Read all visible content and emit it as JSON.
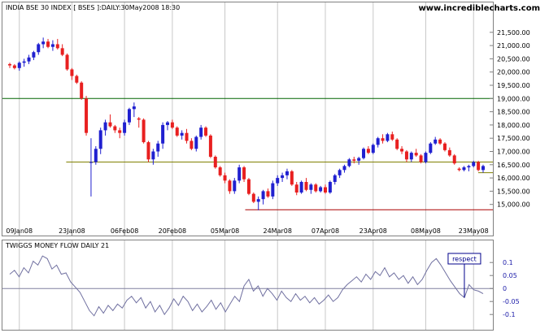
{
  "chart_data": [
    {
      "type": "candlestick",
      "title": "INDIA BSE 30 INDEX [ BSES ]:DAILY:30May2008 18:30",
      "brand": "www.incrediblecharts.com",
      "x_tick_labels": [
        "09Jan08",
        "23Jan08",
        "06Feb08",
        "20Feb08",
        "05Mar08",
        "24Mar08",
        "07Apr08",
        "23Apr08",
        "08May08",
        "23May08"
      ],
      "ylim": [
        14500,
        21800
      ],
      "y_ticks": [
        15000,
        15500,
        16000,
        16500,
        17000,
        17500,
        18000,
        18500,
        19000,
        19500,
        20000,
        20500,
        21000,
        21500
      ],
      "y_tick_labels": [
        "15,000.00",
        "15,500.00",
        "16,000.00",
        "16,500.00",
        "17,000.00",
        "17,500.00",
        "18,000.00",
        "18,500.00",
        "19,000.00",
        "19,500.00",
        "20,000.00",
        "20,500.00",
        "21,000.00",
        "21,500.00"
      ],
      "up_color": "#2020d0",
      "down_color": "#e82020",
      "candles": [
        [
          20300,
          20350,
          20150,
          20250
        ],
        [
          20250,
          20300,
          20100,
          20150
        ],
        [
          20150,
          20400,
          20050,
          20350
        ],
        [
          20350,
          20500,
          20200,
          20400
        ],
        [
          20400,
          20650,
          20300,
          20550
        ],
        [
          20550,
          20800,
          20450,
          20750
        ],
        [
          20750,
          21100,
          20650,
          21050
        ],
        [
          21050,
          21300,
          20900,
          21150
        ],
        [
          21150,
          21250,
          20900,
          20950
        ],
        [
          20950,
          21200,
          20800,
          21050
        ],
        [
          21050,
          21250,
          20850,
          20900
        ],
        [
          20900,
          21050,
          20600,
          20650
        ],
        [
          20650,
          20700,
          20050,
          20100
        ],
        [
          20100,
          20150,
          19700,
          19850
        ],
        [
          19850,
          19900,
          19550,
          19600
        ],
        [
          19600,
          19650,
          18950,
          19000
        ],
        [
          19000,
          19100,
          17600,
          17700
        ],
        [
          16600,
          17500,
          15300,
          16600
        ],
        [
          16600,
          17200,
          16500,
          17100
        ],
        [
          17100,
          17900,
          16900,
          17800
        ],
        [
          17800,
          18200,
          17600,
          18100
        ],
        [
          18100,
          18400,
          17900,
          17950
        ],
        [
          17950,
          18000,
          17700,
          17800
        ],
        [
          17800,
          17900,
          17500,
          17700
        ],
        [
          17700,
          18200,
          17600,
          18100
        ],
        [
          18100,
          18650,
          18000,
          18600
        ],
        [
          18600,
          18850,
          18300,
          18700
        ],
        [
          18250,
          18300,
          17900,
          18200
        ],
        [
          18200,
          18250,
          17300,
          17350
        ],
        [
          17350,
          17400,
          16600,
          16700
        ],
        [
          16700,
          17100,
          16500,
          17000
        ],
        [
          17000,
          17400,
          16800,
          17300
        ],
        [
          17300,
          18100,
          17100,
          18000
        ],
        [
          18000,
          18150,
          17800,
          18100
        ],
        [
          18100,
          18200,
          17850,
          17900
        ],
        [
          17900,
          17950,
          17550,
          17600
        ],
        [
          17600,
          17800,
          17450,
          17700
        ],
        [
          17700,
          17850,
          17300,
          17400
        ],
        [
          17400,
          17500,
          17050,
          17100
        ],
        [
          17100,
          17600,
          17000,
          17550
        ],
        [
          17550,
          18000,
          17450,
          17900
        ],
        [
          17900,
          17950,
          17550,
          17600
        ],
        [
          17600,
          17650,
          16750,
          16800
        ],
        [
          16800,
          16850,
          16350,
          16400
        ],
        [
          16400,
          16450,
          16050,
          16100
        ],
        [
          16100,
          16200,
          15800,
          15900
        ],
        [
          15900,
          15950,
          15400,
          15500
        ],
        [
          15500,
          16000,
          15400,
          15900
        ],
        [
          15900,
          16500,
          15800,
          16400
        ],
        [
          16400,
          16450,
          15850,
          15950
        ],
        [
          15950,
          16000,
          15350,
          15400
        ],
        [
          15400,
          15450,
          15050,
          15100
        ],
        [
          15100,
          15300,
          14780,
          15200
        ],
        [
          15200,
          15550,
          15000,
          15500
        ],
        [
          15500,
          15600,
          15250,
          15300
        ],
        [
          15300,
          15900,
          15200,
          15800
        ],
        [
          15800,
          16100,
          15700,
          16000
        ],
        [
          16000,
          16200,
          15850,
          16100
        ],
        [
          16100,
          16350,
          15950,
          16250
        ],
        [
          16250,
          16300,
          15700,
          15750
        ],
        [
          15750,
          15850,
          15350,
          15450
        ],
        [
          15450,
          15900,
          15400,
          15850
        ],
        [
          15850,
          16000,
          15500,
          15550
        ],
        [
          15550,
          15800,
          15400,
          15750
        ],
        [
          15750,
          15800,
          15450,
          15500
        ],
        [
          15500,
          15700,
          15450,
          15650
        ],
        [
          15650,
          15750,
          15400,
          15450
        ],
        [
          15450,
          15900,
          15400,
          15850
        ],
        [
          15850,
          16150,
          15750,
          16100
        ],
        [
          16100,
          16350,
          16000,
          16300
        ],
        [
          16300,
          16500,
          16200,
          16450
        ],
        [
          16450,
          16750,
          16400,
          16700
        ],
        [
          16700,
          16800,
          16550,
          16650
        ],
        [
          16650,
          16800,
          16500,
          16750
        ],
        [
          16750,
          17150,
          16700,
          17100
        ],
        [
          17100,
          17200,
          16900,
          16950
        ],
        [
          16950,
          17300,
          16900,
          17250
        ],
        [
          17250,
          17550,
          17150,
          17500
        ],
        [
          17500,
          17650,
          17300,
          17400
        ],
        [
          17400,
          17700,
          17350,
          17650
        ],
        [
          17650,
          17750,
          17400,
          17450
        ],
        [
          17450,
          17500,
          17050,
          17100
        ],
        [
          17100,
          17200,
          16900,
          17000
        ],
        [
          17000,
          17050,
          16600,
          16700
        ],
        [
          16700,
          17000,
          16600,
          16950
        ],
        [
          16950,
          17100,
          16800,
          16850
        ],
        [
          16850,
          16900,
          16550,
          16600
        ],
        [
          16600,
          17000,
          16550,
          16950
        ],
        [
          16950,
          17350,
          16900,
          17300
        ],
        [
          17300,
          17550,
          17250,
          17450
        ],
        [
          17450,
          17500,
          17250,
          17300
        ],
        [
          17300,
          17350,
          17000,
          17050
        ],
        [
          17050,
          17150,
          16800,
          16850
        ],
        [
          16850,
          16900,
          16500,
          16550
        ],
        [
          16350,
          16400,
          16250,
          16300
        ],
        [
          16300,
          16450,
          16250,
          16400
        ],
        [
          16400,
          16500,
          16250,
          16450
        ],
        [
          16450,
          16650,
          16400,
          16600
        ],
        [
          16600,
          16650,
          16250,
          16300
        ],
        [
          16300,
          16500,
          16200,
          16450
        ]
      ],
      "support_lines": [
        {
          "value": 19000,
          "x_from": 0,
          "x_to": 1,
          "color": "#006400"
        },
        {
          "value": 16600,
          "x_from": 0.13,
          "x_to": 1,
          "color": "#808000"
        },
        {
          "value": 16200,
          "x_from": 0.97,
          "x_to": 1,
          "color": "#808000"
        },
        {
          "value": 14800,
          "x_from": 0.495,
          "x_to": 1,
          "color": "#aa0000"
        }
      ]
    },
    {
      "type": "line",
      "title": "TWIGGS MONEY FLOW DAILY 21",
      "ylim": [
        -0.14,
        0.135
      ],
      "y_ticks": [
        0.1,
        0.05,
        0,
        -0.05,
        -0.1
      ],
      "y_tick_labels": [
        "0.1",
        "0.05",
        "0",
        "-0.05",
        "-0.1"
      ],
      "line_color": "#7070a0",
      "zero_line_color": "#8080a0",
      "values": [
        0.055,
        0.07,
        0.045,
        0.08,
        0.06,
        0.105,
        0.09,
        0.125,
        0.115,
        0.075,
        0.09,
        0.055,
        0.06,
        0.025,
        0.005,
        -0.015,
        -0.05,
        -0.085,
        -0.105,
        -0.07,
        -0.095,
        -0.065,
        -0.085,
        -0.06,
        -0.075,
        -0.045,
        -0.03,
        -0.055,
        -0.035,
        -0.075,
        -0.05,
        -0.09,
        -0.065,
        -0.1,
        -0.075,
        -0.04,
        -0.065,
        -0.03,
        -0.05,
        -0.085,
        -0.06,
        -0.09,
        -0.07,
        -0.045,
        -0.08,
        -0.055,
        -0.09,
        -0.06,
        -0.03,
        -0.05,
        0.01,
        0.035,
        -0.01,
        0.01,
        -0.03,
        0.0,
        -0.02,
        -0.045,
        -0.01,
        -0.035,
        -0.05,
        -0.02,
        -0.045,
        -0.03,
        -0.055,
        -0.035,
        -0.06,
        -0.045,
        -0.025,
        -0.05,
        -0.035,
        -0.005,
        0.015,
        0.03,
        0.045,
        0.025,
        0.055,
        0.035,
        0.065,
        0.05,
        0.08,
        0.045,
        0.06,
        0.035,
        0.05,
        0.02,
        0.045,
        0.015,
        0.035,
        0.07,
        0.1,
        0.115,
        0.09,
        0.06,
        0.03,
        0.005,
        -0.02,
        -0.035,
        0.015,
        -0.005,
        -0.01,
        -0.02
      ],
      "annotation": {
        "text": "respect",
        "index": 97
      }
    }
  ]
}
